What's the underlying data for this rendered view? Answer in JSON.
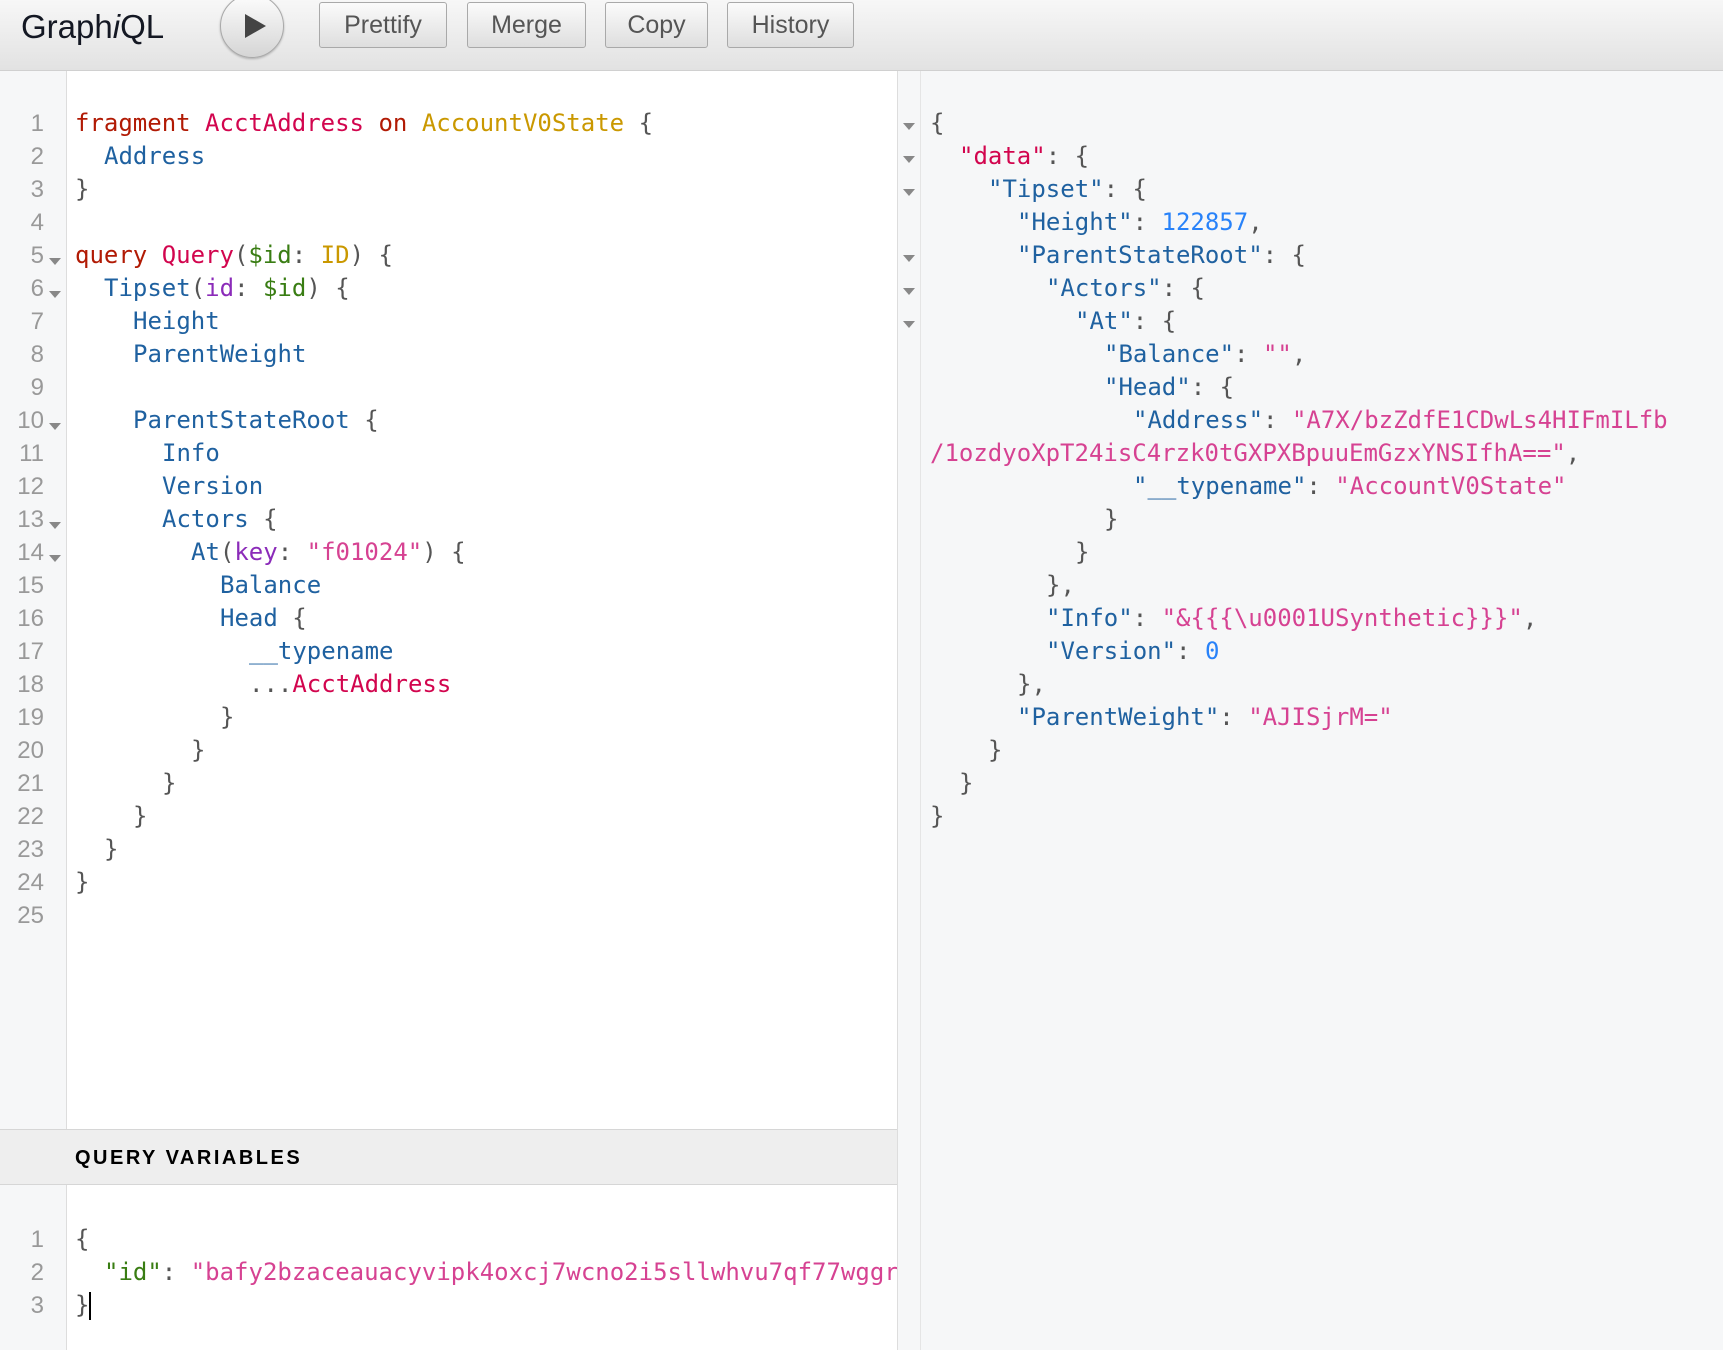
{
  "app": {
    "title_prefix": "Graph",
    "title_italic": "i",
    "title_suffix": "QL"
  },
  "toolbar": {
    "run_label": "Execute Query",
    "prettify": "Prettify",
    "merge": "Merge",
    "copy": "Copy",
    "history": "History"
  },
  "query_editor": {
    "line_numbers": [
      "1",
      "2",
      "3",
      "4",
      "5",
      "6",
      "7",
      "8",
      "9",
      "10",
      "11",
      "12",
      "13",
      "14",
      "15",
      "16",
      "17",
      "18",
      "19",
      "20",
      "21",
      "22",
      "23",
      "24",
      "25"
    ],
    "tokens": {
      "l1_kw": "fragment",
      "l1_name": "AcctAddress",
      "l1_on": "on",
      "l1_type": "AccountV0State",
      "l1_brace": "{",
      "l2_field": "Address",
      "l3": "}",
      "l5_kw": "query",
      "l5_name": "Query",
      "l5_paren": "(",
      "l5_var": "$id",
      "l5_colon": ": ",
      "l5_type": "ID",
      "l5_close": ") {",
      "l6_field": "Tipset",
      "l6_paren": "(",
      "l6_arg": "id",
      "l6_colon": ": ",
      "l6_var": "$id",
      "l6_close": ") {",
      "l7_field": "Height",
      "l8_field": "ParentWeight",
      "l10_field": "ParentStateRoot",
      "l10_brace": " {",
      "l11_field": "Info",
      "l12_field": "Version",
      "l13_field": "Actors",
      "l13_brace": " {",
      "l14_field": "At",
      "l14_paren": "(",
      "l14_arg": "key",
      "l14_colon": ": ",
      "l14_str": "\"f01024\"",
      "l14_close": ") {",
      "l15_field": "Balance",
      "l16_field": "Head",
      "l16_brace": " {",
      "l17_field": "__typename",
      "l18_spread": "...",
      "l18_frag": "AcctAddress",
      "l19": "}",
      "l20": "}",
      "l21": "}",
      "l22": "}",
      "l23": "}",
      "l24": "}"
    }
  },
  "variables": {
    "header": "QUERY VARIABLES",
    "line_numbers": [
      "1",
      "2",
      "3"
    ],
    "l1": "{",
    "l2_key": "\"id\"",
    "l2_colon": ": ",
    "l2_value": "\"bafy2bzaceauacyvipk4oxcj7wcno2i5sllwhvu7qf77wggr",
    "l3": "}"
  },
  "result": {
    "l1": "{",
    "l2_key": "\"data\"",
    "l2_rest": ": {",
    "l3_key": "\"Tipset\"",
    "l3_rest": ": {",
    "l4_key": "\"Height\"",
    "l4_colon": ": ",
    "l4_num": "122857",
    "l4_comma": ",",
    "l5_key": "\"ParentStateRoot\"",
    "l5_rest": ": {",
    "l6_key": "\"Actors\"",
    "l6_rest": ": {",
    "l7_key": "\"At\"",
    "l7_rest": ": {",
    "l8_key": "\"Balance\"",
    "l8_colon": ": ",
    "l8_str": "\"\"",
    "l8_comma": ",",
    "l9_key": "\"Head\"",
    "l9_rest": ": {",
    "l10_key": "\"Address\"",
    "l10_colon": ": ",
    "l10_str": "\"A7X/bzZdfE1CDwLs4HIFmILfb",
    "l11_str": "/1ozdyoXpT24isC4rzk0tGXPXBpuuEmGzxYNSIfhA==\"",
    "l11_comma": ",",
    "l12_key": "\"__typename\"",
    "l12_colon": ": ",
    "l12_str": "\"AccountV0State\"",
    "l13": "}",
    "l14": "}",
    "l15": "},",
    "l16_key": "\"Info\"",
    "l16_colon": ": ",
    "l16_str": "\"&{{{\\u0001USynthetic}}}\"",
    "l16_comma": ",",
    "l17_key": "\"Version\"",
    "l17_colon": ": ",
    "l17_num": "0",
    "l18": "},",
    "l19_key": "\"ParentWeight\"",
    "l19_colon": ": ",
    "l19_str": "\"AJISjrM=\"",
    "l20": "}",
    "l21": "}",
    "l22": "}"
  }
}
